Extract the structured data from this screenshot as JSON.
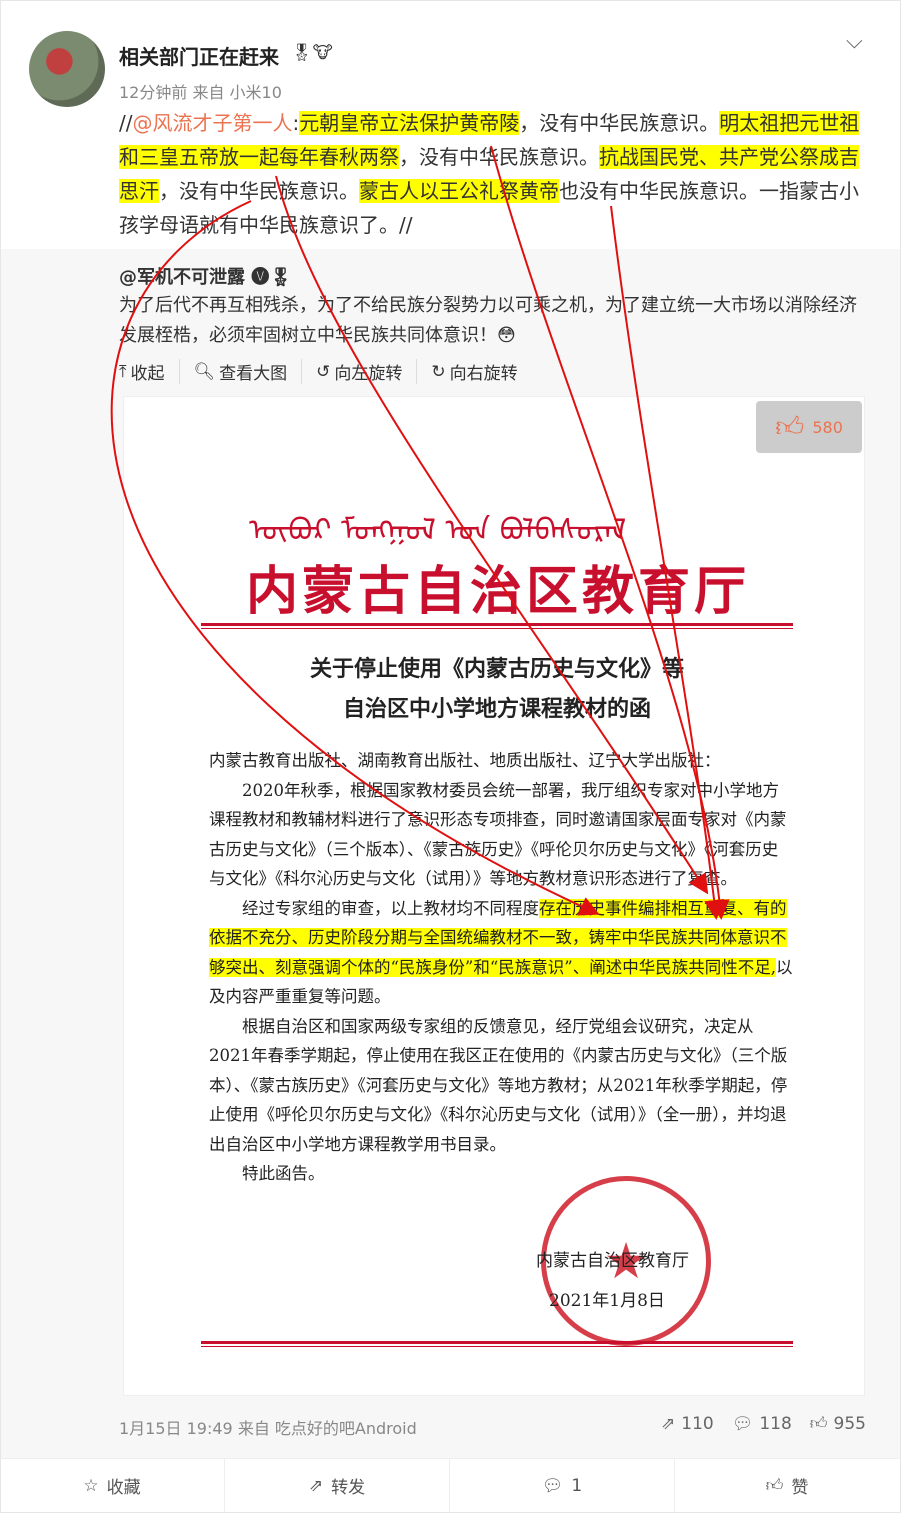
{
  "post": {
    "username": "相关部门正在赶来",
    "badges": "🎖🐮",
    "meta": "12分钟前 来自 小米10",
    "text": {
      "prefix": "//",
      "mention": "@风流才子第一人",
      "colon": ":",
      "h1": "元朝皇帝立法保护黄帝陵",
      "t1": "，没有中华民族意识。",
      "h2": "明太祖把元世祖和三皇五帝放一起每年春秋两祭",
      "t2": "，没有中华民族意识。",
      "h3": "抗战国民党、共产党公祭成吉思汗",
      "t3": "，没有中华民族意识。",
      "h4": "蒙古人以王公礼祭黄帝",
      "t4": "也没有中华民族意识。一指蒙古小孩学母语就有中华民族意识了。//"
    }
  },
  "quoted": {
    "username": "@军机不可泄露",
    "badges": "🅥🎖",
    "text": "为了后代不再互相残杀，为了不给民族分裂势力以可乘之机，为了建立统一大市场以消除经济发展桎梏，必须牢固树立中华民族共同体意识！😳",
    "tools": {
      "collapse": "收起",
      "view_large": "查看大图",
      "rotate_left": "向左旋转",
      "rotate_right": "向右旋转"
    },
    "image_like_count": "580",
    "document": {
      "mongolian_script": "ᠥᠪᠦᠷ ᠮᠣᠩᠭᠣᠯ ᠤᠨ ᠪᠣᠯᠪᠠᠰᠤᠷᠠᠯ",
      "header": "内蒙古自治区教育厅",
      "title_line1": "关于停止使用《内蒙古历史与文化》等",
      "title_line2": "自治区中小学地方课程教材的函",
      "addressee": "内蒙古教育出版社、湖南教育出版社、地质出版社、辽宁大学出版社：",
      "p1": "2020年秋季，根据国家教材委员会统一部署，我厅组织专家对中小学地方课程教材和教辅材料进行了意识形态专项排查，同时邀请国家层面专家对《内蒙古历史与文化》（三个版本）、《蒙古族历史》《呼伦贝尔历史与文化》《河套历史与文化》《科尔沁历史与文化（试用）》等地方教材意识形态进行了复查。",
      "p2_start": "经过专家组的审查，以上教材均不同程度",
      "p2_highlight": "存在历史事件编排相互重复、有的依据不充分、历史阶段分期与全国统编教材不一致，铸牢中华民族共同体意识不够突出、刻意强调个体的“民族身份”和“民族意识”、阐述中华民族共同性不足,",
      "p2_end": "以及内容严重重复等问题。",
      "p3": "根据自治区和国家两级专家组的反馈意见，经厅党组会议研究，决定从2021年春季学期起，停止使用在我区正在使用的《内蒙古历史与文化》（三个版本）、《蒙古族历史》《河套历史与文化》等地方教材；从2021年秋季学期起，停止使用《呼伦贝尔历史与文化》《科尔沁历史与文化（试用）》（全一册），并均退出自治区中小学地方课程教学用书目录。",
      "p4": "特此函告。",
      "signature": "内蒙古自治区教育厅",
      "date": "2021年1月8日",
      "seal_symbol": "★"
    },
    "time": "1月15日 19:49 来自 吃点好的吧Android",
    "reposts": "110",
    "comments": "118",
    "likes": "955"
  },
  "footer": {
    "favorite": "收藏",
    "repost": "转发",
    "comment": "1",
    "like": "赞"
  },
  "colors": {
    "highlight": "#ffff00",
    "link": "#eb7350",
    "arrow": "#e01010",
    "seal": "#d01e2a"
  }
}
